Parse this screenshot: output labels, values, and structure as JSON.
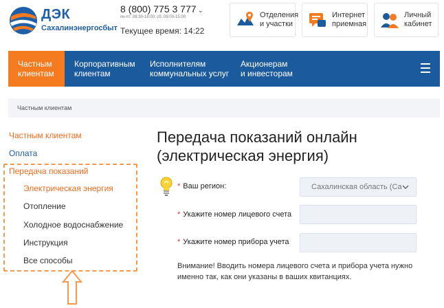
{
  "logo": {
    "name": "ДЭК",
    "subtitle": "Сахалинэнергосбыт"
  },
  "header": {
    "phone": "8 (800) 775 3 777",
    "hours": "пн-пт: 08:30-18:00; сб: 09:00-15:00",
    "current_time": "Текущее время: 14:22",
    "buttons": [
      {
        "label": "Отделения\nи участки",
        "icon": "map-icon"
      },
      {
        "label": "Интернет\nприемная",
        "icon": "chat-icon"
      },
      {
        "label": "Личный\nкабинет",
        "icon": "users-icon"
      }
    ]
  },
  "nav": {
    "items": [
      {
        "label": "Частным\nклиентам"
      },
      {
        "label": "Корпоративным\nклиентам"
      },
      {
        "label": "Исполнителям\nкоммунальных услуг"
      },
      {
        "label": "Акционерам\nи инвесторам"
      }
    ]
  },
  "breadcrumb": "Частным клиентам",
  "sidebar": {
    "items": [
      {
        "label": "Частным клиентам"
      },
      {
        "label": "Оплата"
      },
      {
        "label": "Передача показаний"
      },
      {
        "label": "Электрическая энергия"
      },
      {
        "label": "Отопление"
      },
      {
        "label": "Холодное водоснабжение"
      },
      {
        "label": "Инструкция"
      },
      {
        "label": "Все способы"
      }
    ]
  },
  "main": {
    "title": "Передача показаний онлайн (электрическая энергия)",
    "form": {
      "required_mark": "*",
      "region_label": "Ваш регион:",
      "region_value": "Сахалинская область (Са",
      "account_label": "Укажите номер лицевого счета",
      "account_value": "",
      "meter_label": "Укажите номер прибора учета",
      "meter_value": ""
    },
    "notice": "Внимание! Вводить номера лицевого счета и прибора учета нужно именно так, как они указаны в ваших квитанциях."
  },
  "colors": {
    "brand_blue": "#1c5a9e",
    "accent_orange": "#f47b20",
    "link_orange": "#f06b1c",
    "annotation_orange": "#f39a4e"
  }
}
